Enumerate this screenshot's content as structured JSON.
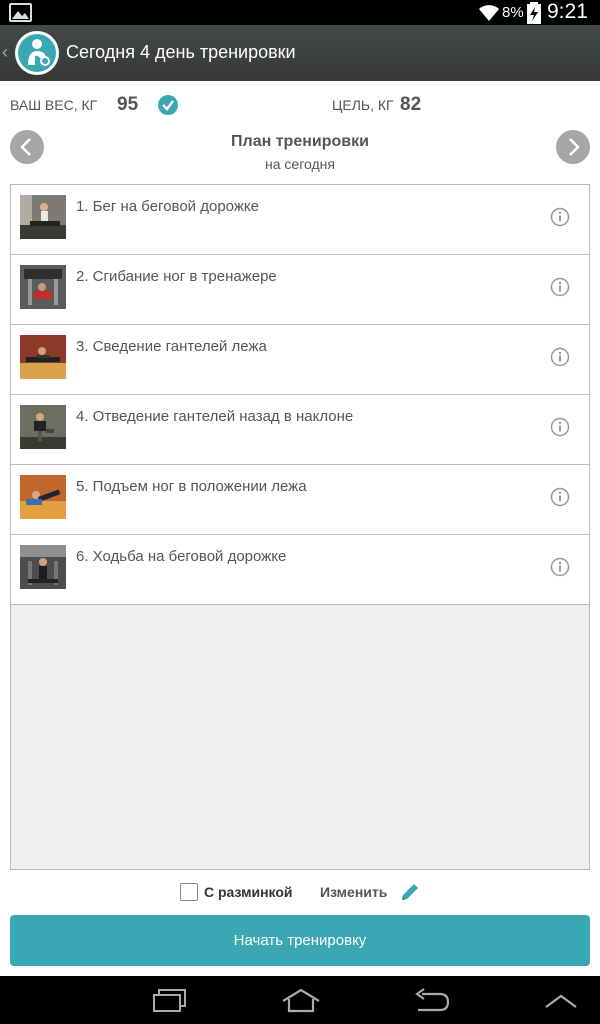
{
  "status_bar": {
    "battery_percent": "8%",
    "time": "9:21",
    "icons": [
      "gallery-icon",
      "wifi-icon",
      "battery-charging-icon"
    ]
  },
  "action_bar": {
    "title": "Сегодня 4 день тренировки",
    "icons": [
      "back-chevron-icon",
      "app-logo-icon"
    ]
  },
  "weight": {
    "current_label": "ВАШ ВЕС, КГ",
    "current_value": "95",
    "goal_label": "ЦЕЛЬ, КГ",
    "goal_value": "82"
  },
  "plan": {
    "title": "План тренировки",
    "subtitle": "на сегодня"
  },
  "exercises": [
    {
      "name": "1. Бег на беговой дорожке"
    },
    {
      "name": "2. Сгибание ног в тренажере"
    },
    {
      "name": "3. Сведение гантелей лежа"
    },
    {
      "name": "4. Отведение гантелей назад в наклоне"
    },
    {
      "name": "5. Подъем ног в положении лежа"
    },
    {
      "name": "6. Ходьба на беговой дорожке"
    }
  ],
  "options": {
    "warmup_label": "С разминкой",
    "warmup_checked": false,
    "edit_label": "Изменить"
  },
  "start_button": {
    "label": "Начать тренировку"
  },
  "colors": {
    "accent": "#3aa7b4",
    "action_bar": "#3c3f41",
    "list_background": "#efefef"
  }
}
